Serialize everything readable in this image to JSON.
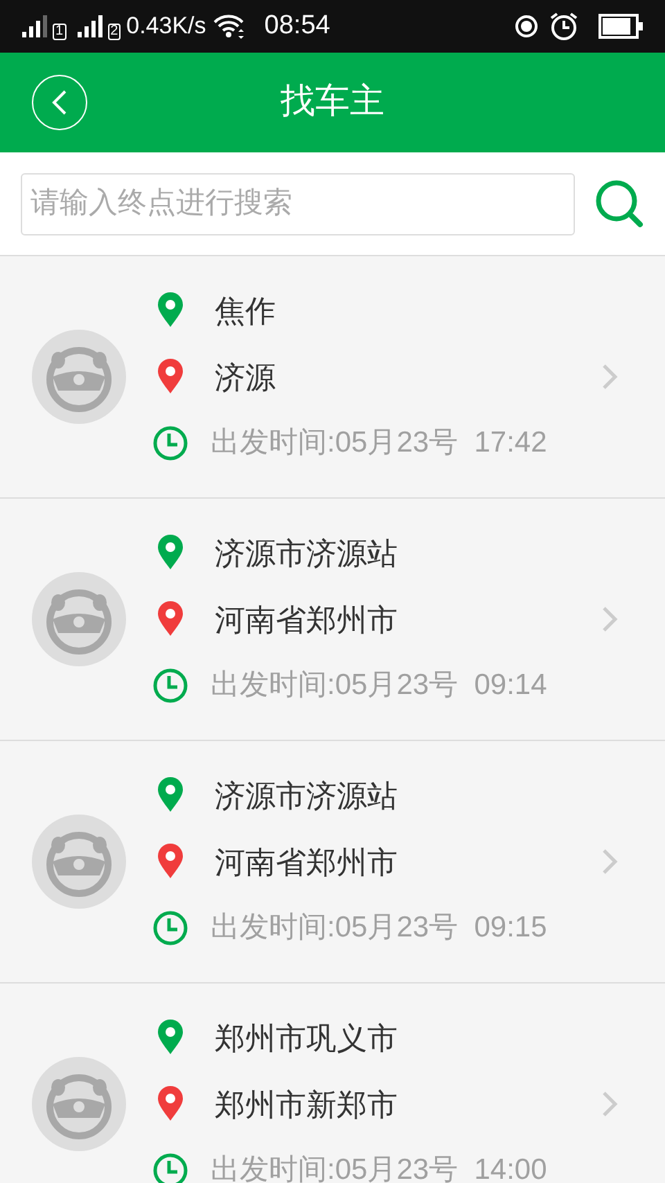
{
  "status_bar": {
    "sim1": "1",
    "sim2": "2",
    "speed": "0.43K/s",
    "time": "08:54"
  },
  "header": {
    "title": "找车主"
  },
  "search": {
    "placeholder": "请输入终点进行搜索"
  },
  "trips": [
    {
      "from": "焦作",
      "to": "济源",
      "departure": "出发时间:05月23号  17:42"
    },
    {
      "from": "济源市济源站",
      "to": "河南省郑州市",
      "departure": "出发时间:05月23号  09:14"
    },
    {
      "from": "济源市济源站",
      "to": "河南省郑州市",
      "departure": "出发时间:05月23号  09:15"
    },
    {
      "from": "郑州市巩义市",
      "to": "郑州市新郑市",
      "departure": "出发时间:05月23号  14:00"
    }
  ]
}
